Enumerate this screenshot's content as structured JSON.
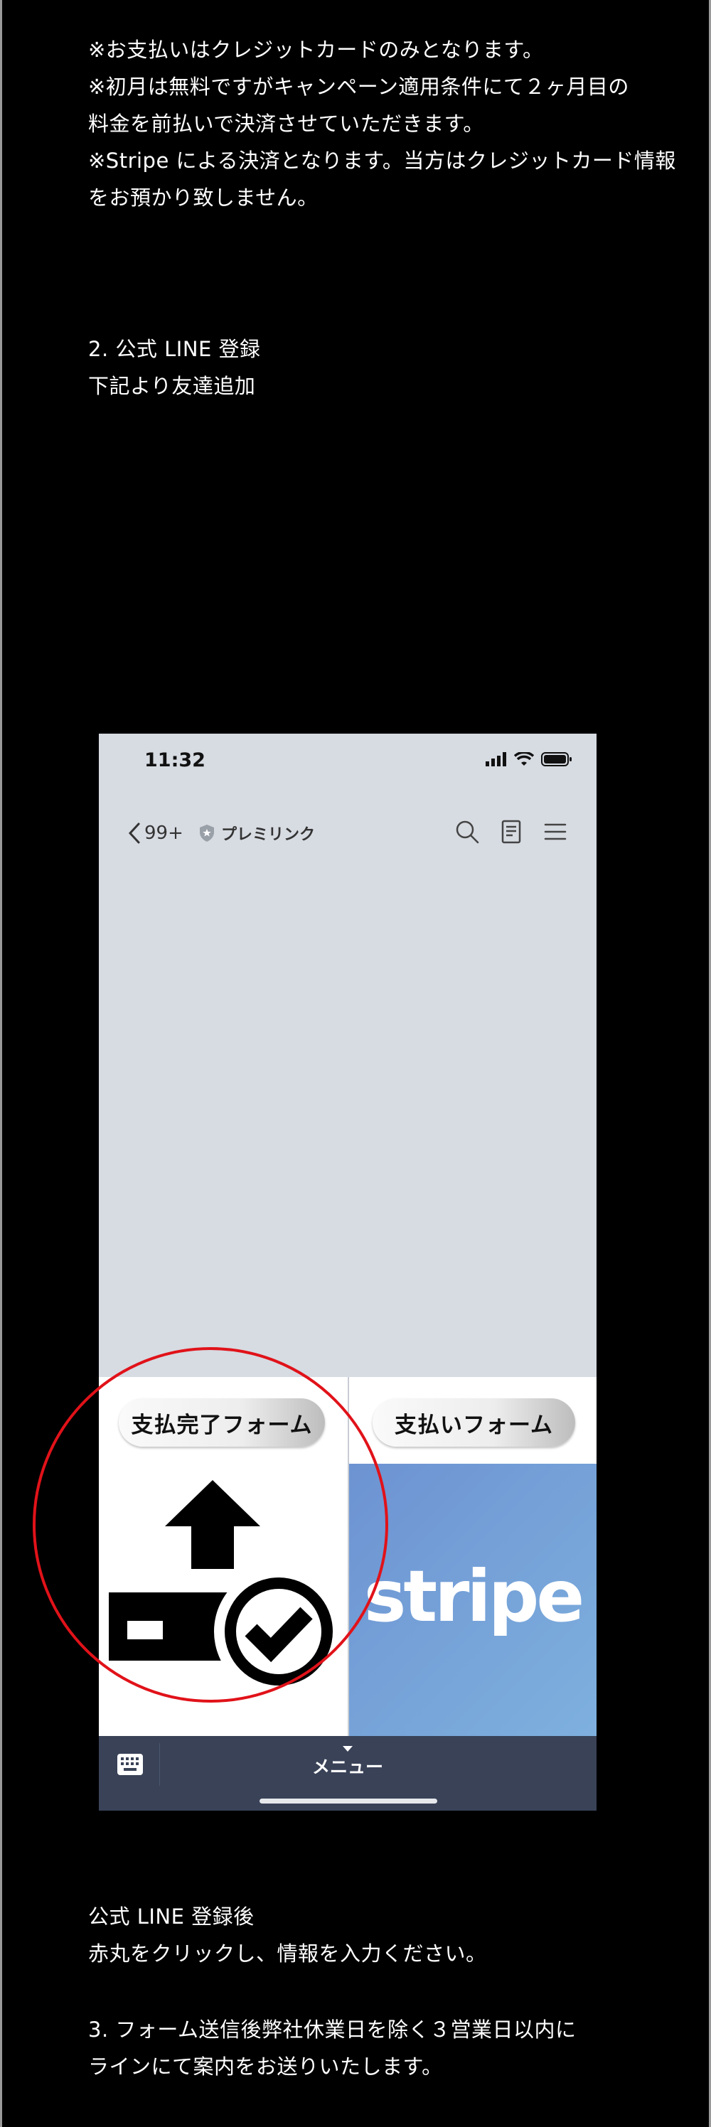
{
  "intro_notes": [
    "※お支払いはクレジットカードのみとなります。",
    "※初月は無料ですがキャンペーン適用条件にて２ヶ月目の",
    "料金を前払いで決済させていただきます。",
    "※Stripe による決済となります。当方はクレジットカード情報",
    "をお預かり致しません。"
  ],
  "step2": {
    "title": "2. 公式 LINE 登録",
    "subtitle": "下記より友達追加"
  },
  "phone": {
    "status_time": "11:32",
    "nav": {
      "back_label": "99+",
      "account_name": "プレミリンク"
    },
    "rich_menu": {
      "left_button": "支払完了フォーム",
      "right_button": "支払いフォーム",
      "right_brand": "stripe"
    },
    "bottom_bar": {
      "menu_label": "メニュー"
    }
  },
  "after_notes": [
    "公式 LINE 登録後",
    "赤丸をクリックし、情報を入力ください。"
  ],
  "step3": [
    "3. フォーム送信後弊社休業日を除く３営業日以内に",
    "ラインにて案内をお送りいたします。"
  ],
  "colors": {
    "page_bg": "#000000",
    "chat_bg": "#d7dbe2",
    "bottom_bar": "#394257",
    "stripe_panel": "#7aa4da",
    "highlight_circle": "#e11219"
  }
}
